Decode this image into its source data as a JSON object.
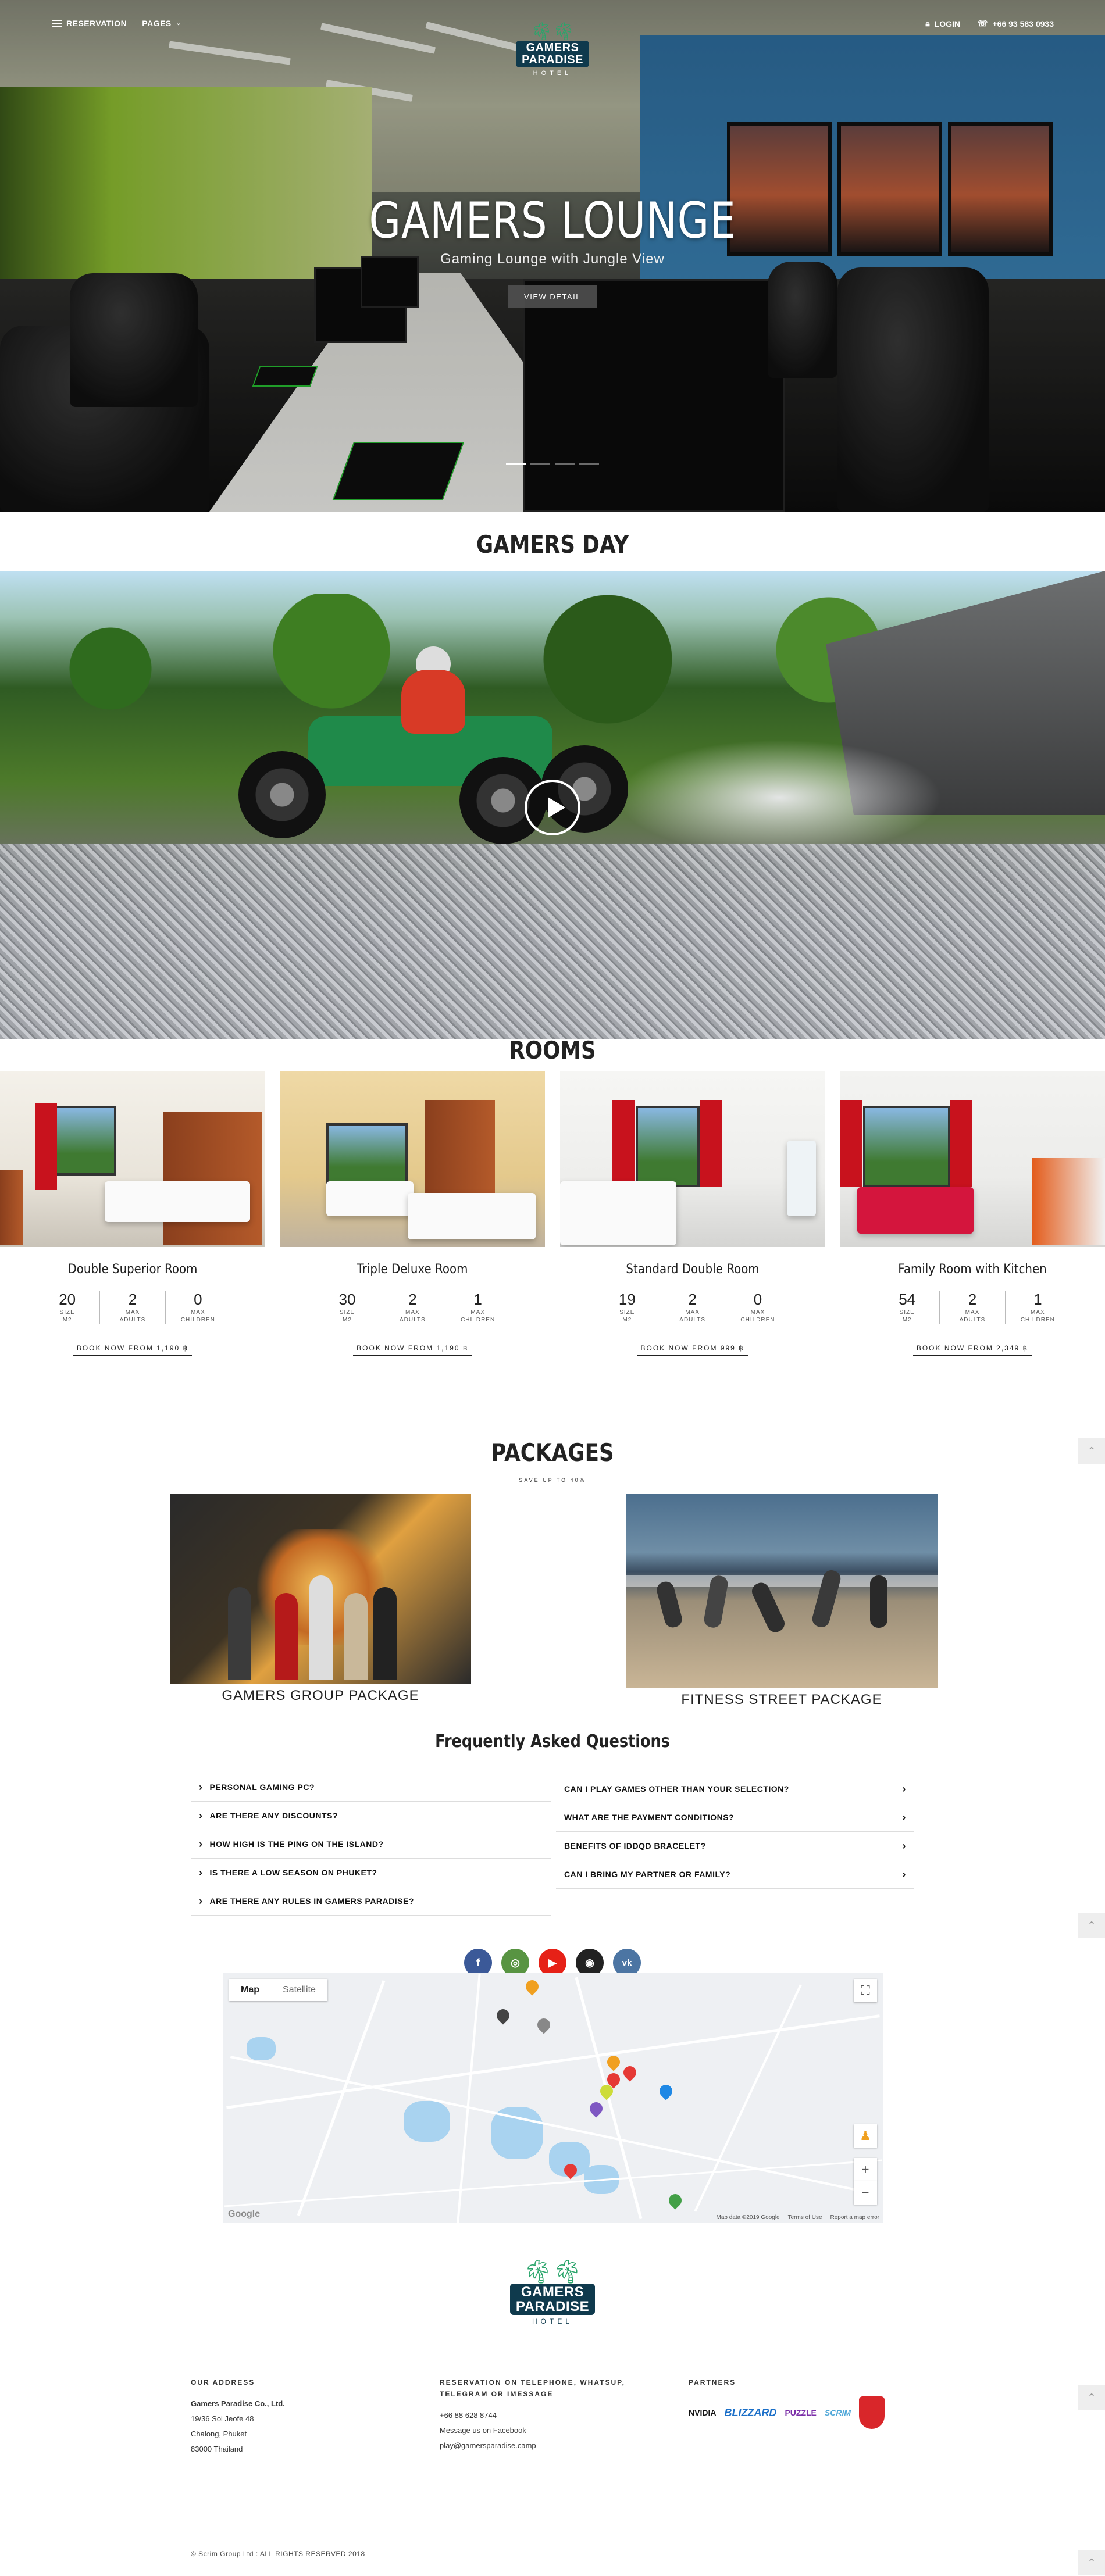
{
  "nav": {
    "reservation": "RESERVATION",
    "pages": "PAGES",
    "login": "LOGIN",
    "phone": "+66 93 583 0933"
  },
  "logo": {
    "line1": "GAMERS",
    "line2": "PARADISE",
    "sub": "HOTEL"
  },
  "hero": {
    "title": "GAMERS LOUNGE",
    "subtitle": "Gaming Lounge with Jungle View",
    "button": "VIEW DETAIL"
  },
  "gamers_day": {
    "title": "GAMERS DAY"
  },
  "rooms": {
    "title": "ROOMS",
    "labels": {
      "size": "SIZE",
      "m2": "M2",
      "max": "MAX",
      "adults": "ADULTS",
      "children": "CHILDREN"
    },
    "items": [
      {
        "name": "Double Superior Room",
        "size": "20",
        "adults": "2",
        "children": "0",
        "book": "BOOK NOW FROM 1,190 ฿"
      },
      {
        "name": "Triple Deluxe Room",
        "size": "30",
        "adults": "2",
        "children": "1",
        "book": "BOOK NOW FROM 1,190 ฿"
      },
      {
        "name": "Standard Double Room",
        "size": "19",
        "adults": "2",
        "children": "0",
        "book": "BOOK NOW FROM 999 ฿"
      },
      {
        "name": "Family Room with Kitchen",
        "size": "54",
        "adults": "2",
        "children": "1",
        "book": "BOOK NOW FROM 2,349 ฿"
      }
    ]
  },
  "packages": {
    "title": "PACKAGES",
    "subtitle": "SAVE UP TO 40%",
    "items": [
      {
        "name": "GAMERS GROUP PACKAGE"
      },
      {
        "name": "FITNESS STREET PACKAGE"
      }
    ]
  },
  "faq": {
    "title": "Frequently Asked Questions",
    "left": [
      "PERSONAL GAMING PC?",
      "ARE THERE ANY DISCOUNTS?",
      "HOW HIGH IS THE PING ON THE ISLAND?",
      "IS THERE A LOW SEASON ON PHUKET?",
      "ARE THERE ANY RULES IN GAMERS PARADISE?"
    ],
    "right": [
      "CAN I PLAY GAMES OTHER THAN YOUR SELECTION?",
      "WHAT ARE THE PAYMENT CONDITIONS?",
      "BENEFITS OF IDDQD BRACELET?",
      "CAN I BRING MY PARTNER OR FAMILY?"
    ]
  },
  "social": [
    {
      "name": "facebook-icon",
      "glyph": "f",
      "color": "#3b5998"
    },
    {
      "name": "tripadvisor-icon",
      "glyph": "◎",
      "color": "#589442"
    },
    {
      "name": "youtube-icon",
      "glyph": "▶",
      "color": "#e62117"
    },
    {
      "name": "instagram-icon",
      "glyph": "◉",
      "color": "#222222"
    },
    {
      "name": "vk-icon",
      "glyph": "vk",
      "color": "#4c75a3"
    }
  ],
  "map": {
    "tab_map": "Map",
    "tab_satellite": "Satellite",
    "zoom_in": "+",
    "zoom_out": "−",
    "fullscreen": "⛶",
    "google": "Google",
    "attribution": "Map data ©2019 Google",
    "terms": "Terms of Use",
    "report": "Report a map error"
  },
  "footer": {
    "address_heading": "OUR ADDRESS",
    "company": "Gamers Paradise Co., Ltd.",
    "address_lines": [
      "19/36 Soi Jeofe 48",
      "Chalong, Phuket",
      "83000 Thailand"
    ],
    "reservation_heading": "RESERVATION ON TELEPHONE, WHATSUP, TELEGRAM OR IMESSAGE",
    "reservation_lines": [
      "+66 88 628 8744",
      "Message us on Facebook",
      "play@gamersparadise.camp"
    ],
    "partners_heading": "PARTNERS",
    "partners": [
      "NVIDIA",
      "BLIZZARD",
      "PUZZLE",
      "SCRIM"
    ],
    "copyright": "© Scrim Group Ltd : ALL RIGHTS RESERVED 2018"
  },
  "colors": {
    "accent": "#0f3a4d",
    "text": "#222222",
    "button_gray": "#505050"
  }
}
